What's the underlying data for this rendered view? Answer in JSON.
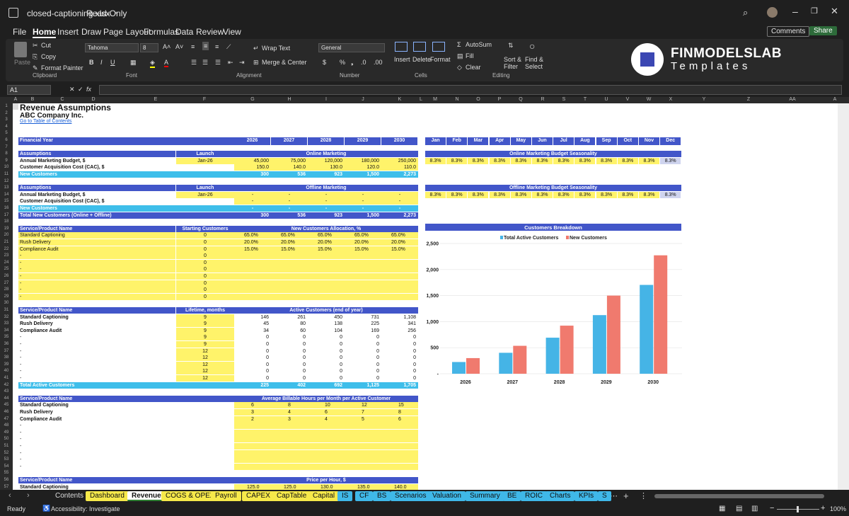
{
  "window": {
    "filename": "closed-captioning.xlsx",
    "mode": "Read-Only"
  },
  "menu": [
    "File",
    "Home",
    "Insert",
    "Draw",
    "Page Layout",
    "Formulas",
    "Data",
    "Review",
    "View"
  ],
  "buttons": {
    "comments": "Comments",
    "share": "Share"
  },
  "ribbon": {
    "paste": "Paste",
    "cut": "Cut",
    "copy": "Copy",
    "format_painter": "Format Painter",
    "clipboard": "Clipboard",
    "font_name": "Tahoma",
    "font_size": "8",
    "font": "Font",
    "wrap": "Wrap Text",
    "merge": "Merge & Center",
    "alignment": "Alignment",
    "number_format": "General",
    "number": "Number",
    "insert": "Insert",
    "delete": "Delete",
    "format": "Format",
    "cells": "Cells",
    "autosum": "AutoSum",
    "fill": "Fill",
    "clear": "Clear",
    "sort": "Sort &",
    "filter": "Filter",
    "find": "Find &",
    "select": "Select",
    "editing": "Editing"
  },
  "logo": {
    "line1": "FINMODELSLAB",
    "line2": "Templates"
  },
  "namebox": "A1",
  "columns": [
    "A",
    "B",
    "C",
    "D",
    "E",
    "F",
    "G",
    "H",
    "I",
    "J",
    "K",
    "L",
    "M",
    "N",
    "O",
    "P",
    "Q",
    "R",
    "S",
    "T",
    "U",
    "V",
    "W",
    "X",
    "Y",
    "Z",
    "AA",
    "A"
  ],
  "sheet": {
    "title": "Revenue Assumptions",
    "company": "ABC Company Inc.",
    "toc": "Go to Table of Contents",
    "fy": "Financial Year",
    "years": [
      "2026",
      "2027",
      "2028",
      "2029",
      "2030"
    ],
    "months": [
      "Jan",
      "Feb",
      "Mar",
      "Apr",
      "May",
      "Jun",
      "Jul",
      "Aug",
      "Sep",
      "Oct",
      "Nov",
      "Dec"
    ],
    "assumptions": "Assumptions",
    "launch": "Launch",
    "online": "Online Marketing",
    "offline": "Offline Marketing",
    "amb": "Annual Marketing Budget, $",
    "cac": "Customer Acquisition Cost (CAC), $",
    "newc": "New Customers",
    "launch_on": "Jan-26",
    "launch_off": "Jan-26",
    "on_budget": [
      "45,000",
      "75,000",
      "120,000",
      "180,000",
      "250,000"
    ],
    "on_cac": [
      "150.0",
      "140.0",
      "130.0",
      "120.0",
      "110.0"
    ],
    "on_new": [
      "300",
      "536",
      "923",
      "1,500",
      "2,273"
    ],
    "dash": "-",
    "tnc": "Total New Customers (Online + Offline)",
    "tnc_vals": [
      "300",
      "536",
      "923",
      "1,500",
      "2,273"
    ],
    "onseason": "Online Marketing Budget Seasonality",
    "offseason": "Offline Marketing Budget Seasonality",
    "pct": "8.3%",
    "spn": "Service/Product Name",
    "starting": "Starting Customers",
    "alloc": "New Customers Allocation, %",
    "services": [
      "Standard Captioning",
      "Rush Delivery",
      "Compliance Audit"
    ],
    "zero": "0",
    "alloc_vals": [
      [
        "65.0%",
        "65.0%",
        "65.0%",
        "65.0%",
        "65.0%"
      ],
      [
        "20.0%",
        "20.0%",
        "20.0%",
        "20.0%",
        "20.0%"
      ],
      [
        "15.0%",
        "15.0%",
        "15.0%",
        "15.0%",
        "15.0%"
      ]
    ],
    "lifetime": "Lifetime, months",
    "active": "Active Customers (end of year)",
    "lt_vals": [
      "9",
      "9",
      "9",
      "9",
      "9",
      "12",
      "12",
      "12",
      "12",
      "12"
    ],
    "active_vals": [
      [
        "146",
        "261",
        "450",
        "731",
        "1,108"
      ],
      [
        "45",
        "80",
        "138",
        "225",
        "341"
      ],
      [
        "34",
        "60",
        "104",
        "169",
        "256"
      ]
    ],
    "tac": "Total Active Customers",
    "tac_vals": [
      "225",
      "402",
      "692",
      "1,125",
      "1,705"
    ],
    "abh": "Average Billable Hours per Month per Active Customer",
    "abh_vals": [
      [
        "6",
        "8",
        "10",
        "12",
        "15"
      ],
      [
        "3",
        "4",
        "6",
        "7",
        "8"
      ],
      [
        "2",
        "3",
        "4",
        "5",
        "6"
      ]
    ],
    "pph": "Price per Hour, $",
    "pph_vals": [
      "125.0",
      "125.0",
      "130.0",
      "135.0",
      "140.0"
    ]
  },
  "chart_data": {
    "type": "bar",
    "title": "Customers Breakdown",
    "categories": [
      "2026",
      "2027",
      "2028",
      "2029",
      "2030"
    ],
    "series": [
      {
        "name": "Total Active Customers",
        "values": [
          225,
          402,
          692,
          1125,
          1705
        ],
        "color": "#45b4e6"
      },
      {
        "name": "New Customers",
        "values": [
          300,
          536,
          923,
          1500,
          2273
        ],
        "color": "#f07a6e"
      }
    ],
    "ylim": [
      0,
      2500
    ],
    "yticks": [
      "2,500",
      "2,000",
      "1,500",
      "1,000",
      "500",
      "-"
    ],
    "legend": "top"
  },
  "tabs": [
    {
      "label": "Contents",
      "bg": "#1f1f1f",
      "fg": "#ddd"
    },
    {
      "label": "Dashboard",
      "bg": "#f6e94a"
    },
    {
      "label": "Revenue",
      "bg": "#ffffff"
    },
    {
      "label": "COGS & OPEX",
      "bg": "#f6e94a"
    },
    {
      "label": "Payroll",
      "bg": "#f6e94a"
    },
    {
      "label": "CAPEX",
      "bg": "#f6e94a"
    },
    {
      "label": "CapTable",
      "bg": "#f6e94a"
    },
    {
      "label": "Capital",
      "bg": "#f6e94a"
    },
    {
      "label": "IS",
      "bg": "#3fb8e8"
    },
    {
      "label": "CF",
      "bg": "#3fb8e8"
    },
    {
      "label": "BS",
      "bg": "#3fb8e8"
    },
    {
      "label": "Scenarios",
      "bg": "#3fb8e8"
    },
    {
      "label": "Valuation",
      "bg": "#3fb8e8"
    },
    {
      "label": "Summary",
      "bg": "#3fb8e8"
    },
    {
      "label": "BE",
      "bg": "#3fb8e8"
    },
    {
      "label": "ROIC",
      "bg": "#3fb8e8"
    },
    {
      "label": "Charts",
      "bg": "#3fb8e8"
    },
    {
      "label": "KPIs",
      "bg": "#3fb8e8"
    },
    {
      "label": "S",
      "bg": "#3fb8e8"
    }
  ],
  "status": {
    "ready": "Ready",
    "access": "Accessibility: Investigate",
    "zoom": "100%"
  }
}
